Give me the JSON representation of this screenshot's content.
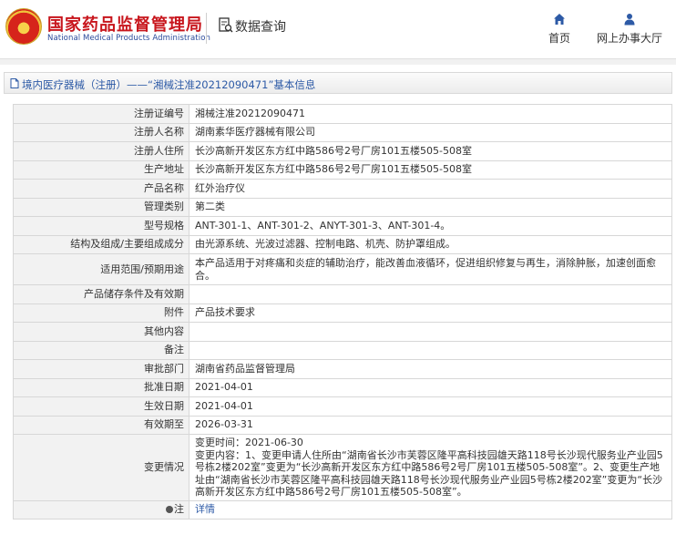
{
  "header": {
    "logo_title": "国家药品监督管理局",
    "logo_subtitle": "National Medical Products Administration",
    "query_title": "数据查询",
    "nav": [
      {
        "label": "首页",
        "icon": "home-icon"
      },
      {
        "label": "网上办事大厅",
        "icon": "user-icon"
      }
    ]
  },
  "breadcrumb": {
    "text": "境内医疗器械（注册）——“湘械注准20212090471”基本信息"
  },
  "record": [
    {
      "key": "注册证编号",
      "value": "湘械注准20212090471"
    },
    {
      "key": "注册人名称",
      "value": "湖南素华医疗器械有限公司"
    },
    {
      "key": "注册人住所",
      "value": "长沙高新开发区东方红中路586号2号厂房101五楼505-508室"
    },
    {
      "key": "生产地址",
      "value": "长沙高新开发区东方红中路586号2号厂房101五楼505-508室"
    },
    {
      "key": "产品名称",
      "value": "红外治疗仪"
    },
    {
      "key": "管理类别",
      "value": "第二类"
    },
    {
      "key": "型号规格",
      "value": "ANT-301-1、ANT-301-2、ANYT-301-3、ANT-301-4。"
    },
    {
      "key": "结构及组成/主要组成成分",
      "value": "由光源系统、光波过滤器、控制电路、机壳、防护罩组成。"
    },
    {
      "key": "适用范围/预期用途",
      "value": "本产品适用于对疼痛和炎症的辅助治疗，能改善血液循环，促进组织修复与再生，消除肿胀，加速创面愈合。"
    },
    {
      "key": "产品储存条件及有效期",
      "value": ""
    },
    {
      "key": "附件",
      "value": "产品技术要求"
    },
    {
      "key": "其他内容",
      "value": ""
    },
    {
      "key": "备注",
      "value": ""
    },
    {
      "key": "审批部门",
      "value": "湖南省药品监督管理局"
    },
    {
      "key": "批准日期",
      "value": "2021-04-01"
    },
    {
      "key": "生效日期",
      "value": "2021-04-01"
    },
    {
      "key": "有效期至",
      "value": "2026-03-31"
    },
    {
      "key": "变更情况",
      "value": "变更时间：2021-06-30\n变更内容：1、变更申请人住所由“湖南省长沙市芙蓉区隆平高科技园雄天路118号长沙现代服务业产业园5号栋2楼202室”变更为“长沙高新开发区东方红中路586号2号厂房101五楼505-508室”。2、变更生产地址由“湖南省长沙市芙蓉区隆平高科技园雄天路118号长沙现代服务业产业园5号栋2楼202室”变更为“长沙高新开发区东方红中路586号2号厂房101五楼505-508室”。"
    }
  ],
  "note": {
    "key": "注",
    "link": "详情"
  },
  "colors": {
    "brand_red": "#c8161d",
    "link_blue": "#2d5aa6",
    "key_bg": "#f2f2f2",
    "border": "#d7d7d7"
  }
}
